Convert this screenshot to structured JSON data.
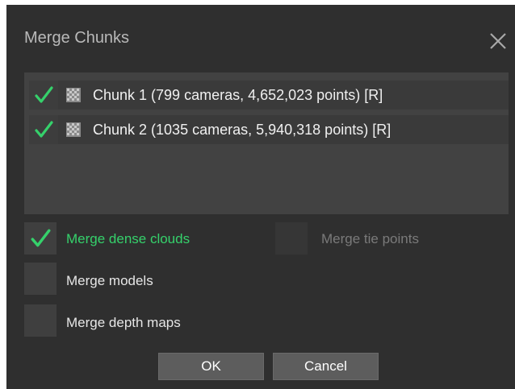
{
  "dialog": {
    "title": "Merge Chunks",
    "close_icon": "close-icon"
  },
  "chunks": [
    {
      "checked": true,
      "label": "Chunk 1 (799 cameras, 4,652,023 points) [R]"
    },
    {
      "checked": true,
      "label": "Chunk 2 (1035 cameras, 5,940,318 points) [R]"
    }
  ],
  "options": {
    "merge_dense_clouds": {
      "label": "Merge dense clouds",
      "checked": true
    },
    "merge_tie_points": {
      "label": "Merge tie points",
      "checked": false,
      "enabled": false
    },
    "merge_models": {
      "label": "Merge models",
      "checked": false
    },
    "merge_depth_maps": {
      "label": "Merge depth maps",
      "checked": false
    }
  },
  "buttons": {
    "ok": "OK",
    "cancel": "Cancel"
  },
  "colors": {
    "accent_green": "#35d16b",
    "dialog_bg": "#2f2f2f"
  }
}
